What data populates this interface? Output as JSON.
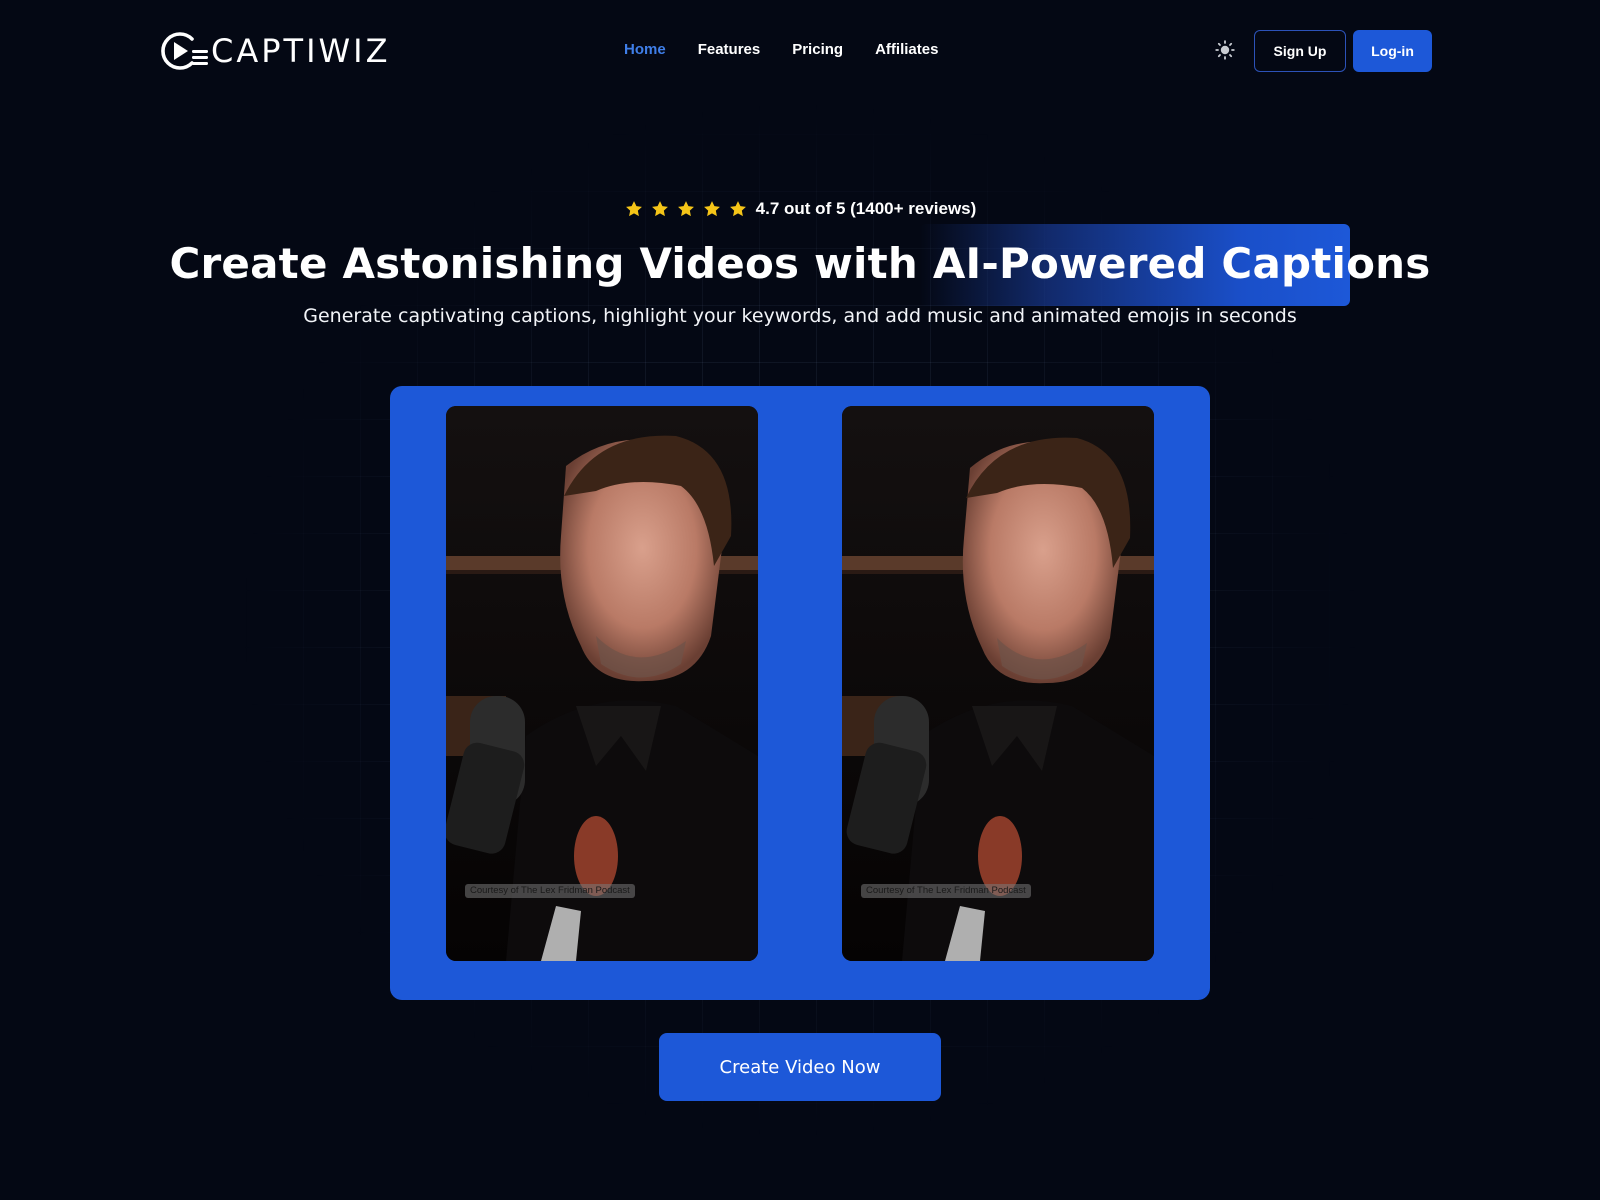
{
  "brand": {
    "name": "CAPTIWIZ",
    "logo_icon": "play-captions-icon"
  },
  "nav": {
    "items": [
      {
        "label": "Home",
        "active": true
      },
      {
        "label": "Features",
        "active": false
      },
      {
        "label": "Pricing",
        "active": false
      },
      {
        "label": "Affiliates",
        "active": false
      }
    ],
    "theme_toggle_icon": "sun-icon",
    "signup_label": "Sign Up",
    "login_label": "Log-in"
  },
  "hero": {
    "rating": {
      "stars": 5,
      "text": "4.7 out of 5 (1400+ reviews)"
    },
    "headline": "Create Astonishing Videos with AI-Powered Captions",
    "headline_highlight": "AI-Powered Captions",
    "subheadline": "Generate captivating captions, highlight your keywords, and add music and animated emojis in seconds"
  },
  "videos": [
    {
      "credit": "Courtesy of The Lex Fridman Podcast"
    },
    {
      "credit": "Courtesy of The Lex Fridman Podcast"
    }
  ],
  "cta": {
    "label": "Create Video Now"
  },
  "colors": {
    "background": "#040814",
    "accent": "#1d58d8",
    "nav_active": "#3f7ee8",
    "star": "#f5c518"
  }
}
